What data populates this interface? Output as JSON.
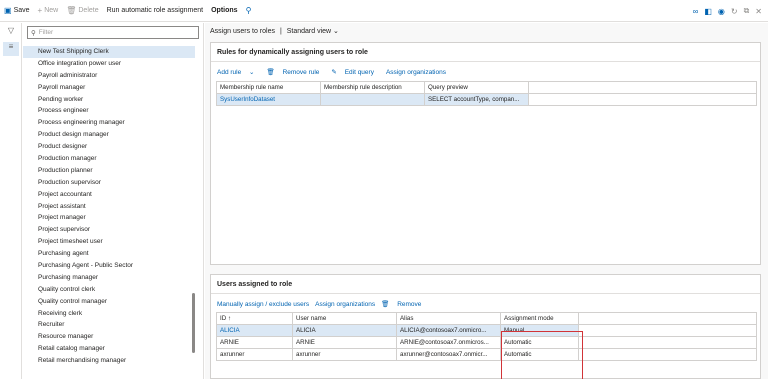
{
  "toolbar": {
    "save": "Save",
    "new": "New",
    "delete": "Delete",
    "run": "Run automatic role assignment",
    "options": "Options"
  },
  "filter": {
    "placeholder": "Filter"
  },
  "roles": [
    "New Test Shipping Clerk",
    "Office integration power user",
    "Payroll administrator",
    "Payroll manager",
    "Pending worker",
    "Process engineer",
    "Process engineering manager",
    "Product design manager",
    "Product designer",
    "Production manager",
    "Production planner",
    "Production supervisor",
    "Project accountant",
    "Project assistant",
    "Project manager",
    "Project supervisor",
    "Project timesheet user",
    "Purchasing agent",
    "Purchasing Agent - Public Sector",
    "Purchasing manager",
    "Quality control clerk",
    "Quality control manager",
    "Receiving clerk",
    "Recruiter",
    "Resource manager",
    "Retail catalog manager",
    "Retail merchandising manager"
  ],
  "breadcrumb": {
    "page": "Assign users to roles",
    "sep": "|",
    "view": "Standard view"
  },
  "rules": {
    "title": "Rules for dynamically assigning users to role",
    "actions": {
      "add": "Add rule",
      "remove": "Remove rule",
      "edit": "Edit query",
      "assign": "Assign organizations"
    },
    "headers": [
      "Membership rule name",
      "Membership rule description",
      "Query preview"
    ],
    "rows": [
      [
        "SysUserInfoDataset",
        "",
        "SELECT accountType, compan..."
      ]
    ]
  },
  "users": {
    "title": "Users assigned to role",
    "actions": {
      "manual": "Manually assign / exclude users",
      "assign": "Assign organizations",
      "remove": "Remove"
    },
    "headers": [
      "ID",
      "User name",
      "Alias",
      "Assignment mode"
    ],
    "sort_arrow": "↑",
    "rows": [
      [
        "ALICIA",
        "ALICIA",
        "ALICIA@contosoax7.onmicro...",
        "Manual"
      ],
      [
        "ARNIE",
        "ARNIE",
        "ARNIE@contosoax7.onmicros...",
        "Automatic"
      ],
      [
        "axrunner",
        "axrunner",
        "axrunner@contosoax7.onmicr...",
        "Automatic"
      ]
    ]
  },
  "colors": {
    "accent": "#0063b1",
    "selected": "#dbe8f5",
    "highlight": "#d13438"
  }
}
